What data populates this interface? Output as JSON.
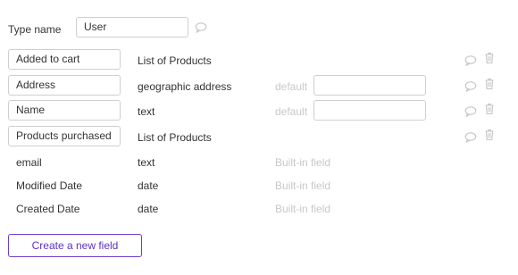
{
  "header": {
    "type_name_label": "Type name",
    "type_name_value": "User"
  },
  "custom_fields": [
    {
      "name": "Added to cart",
      "type": "List of Products",
      "default_label": ""
    },
    {
      "name": "Address",
      "type": "geographic address",
      "default_label": "default"
    },
    {
      "name": "Name",
      "type": "text",
      "default_label": "default"
    },
    {
      "name": "Products purchased",
      "type": "List of Products",
      "default_label": ""
    }
  ],
  "builtin_fields": [
    {
      "name": "email",
      "type": "text",
      "note": "Built-in field"
    },
    {
      "name": "Modified Date",
      "type": "date",
      "note": "Built-in field"
    },
    {
      "name": "Created Date",
      "type": "date",
      "note": "Built-in field"
    }
  ],
  "actions": {
    "create_field_label": "Create a new field"
  },
  "icons": {
    "comment": "comment-bubble-icon",
    "delete": "trash-icon"
  },
  "colors": {
    "accent": "#5b31c8",
    "border": "#cfcfcf",
    "muted_text": "#c8c8c8",
    "icon": "#c4c4c4"
  }
}
